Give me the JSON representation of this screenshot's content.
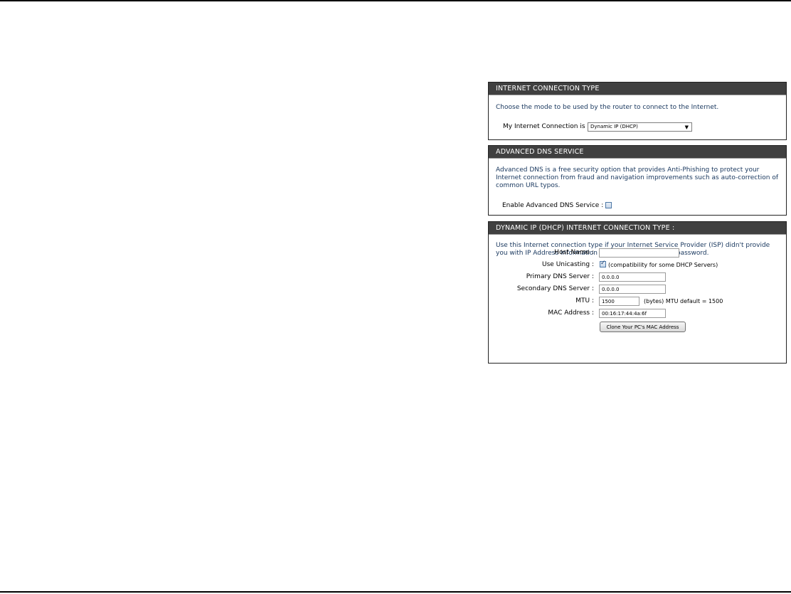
{
  "connection_type": {
    "header": "INTERNET CONNECTION TYPE",
    "description": "Choose the mode to be used by the router to connect to the Internet.",
    "field_label": "My Internet Connection is :",
    "selected_value": "Dynamic IP (DHCP)"
  },
  "advanced_dns": {
    "header": "ADVANCED DNS SERVICE",
    "description": "Advanced DNS is a free security option that provides Anti-Phishing to protect your Internet connection from fraud and navigation improvements such as auto-correction of common URL typos.",
    "enable_label": "Enable Advanced DNS Service :",
    "enabled": false
  },
  "dhcp": {
    "header": "DYNAMIC IP (DHCP) INTERNET CONNECTION TYPE :",
    "description": "Use this Internet connection type if your Internet Service Provider (ISP) didn't provide you with IP Address information and/or a username and password.",
    "host_name_label": "Host Name :",
    "host_name_value": "",
    "unicasting_label": "Use Unicasting :",
    "unicasting_checked": true,
    "unicasting_note": "(compatibility for some DHCP Servers)",
    "primary_dns_label": "Primary DNS Server :",
    "primary_dns_value": "0.0.0.0",
    "secondary_dns_label": "Secondary DNS Server :",
    "secondary_dns_value": "0.0.0.0",
    "mtu_label": "MTU :",
    "mtu_value": "1500",
    "mtu_note": "(bytes) MTU default = 1500",
    "mac_label": "MAC Address :",
    "mac_value": "00:16:17:44:4a:6f",
    "clone_button": "Clone Your PC's MAC Address"
  }
}
